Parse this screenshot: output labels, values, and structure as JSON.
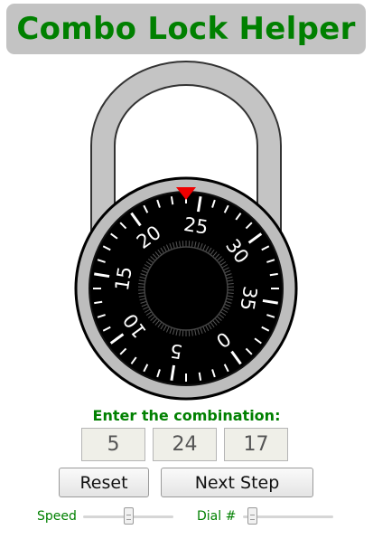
{
  "header": {
    "title": "Combo Lock Helper"
  },
  "lock": {
    "current_dial_value": 24,
    "max_value": 39,
    "dial_labels": [
      "0",
      "5",
      "10",
      "15",
      "20",
      "25",
      "30",
      "35"
    ],
    "colors": {
      "shackle": "#c4c4c4",
      "body": "#bdbdbd",
      "dial": "#000000",
      "indicator": "#ee0000",
      "marks": "#ffffff"
    }
  },
  "combination": {
    "prompt": "Enter the combination:",
    "values": [
      "5",
      "24",
      "17"
    ]
  },
  "buttons": {
    "reset_label": "Reset",
    "next_label": "Next Step"
  },
  "sliders": {
    "speed": {
      "label": "Speed",
      "level": 0.5
    },
    "dial": {
      "label": "Dial #",
      "level": 0.1
    }
  }
}
